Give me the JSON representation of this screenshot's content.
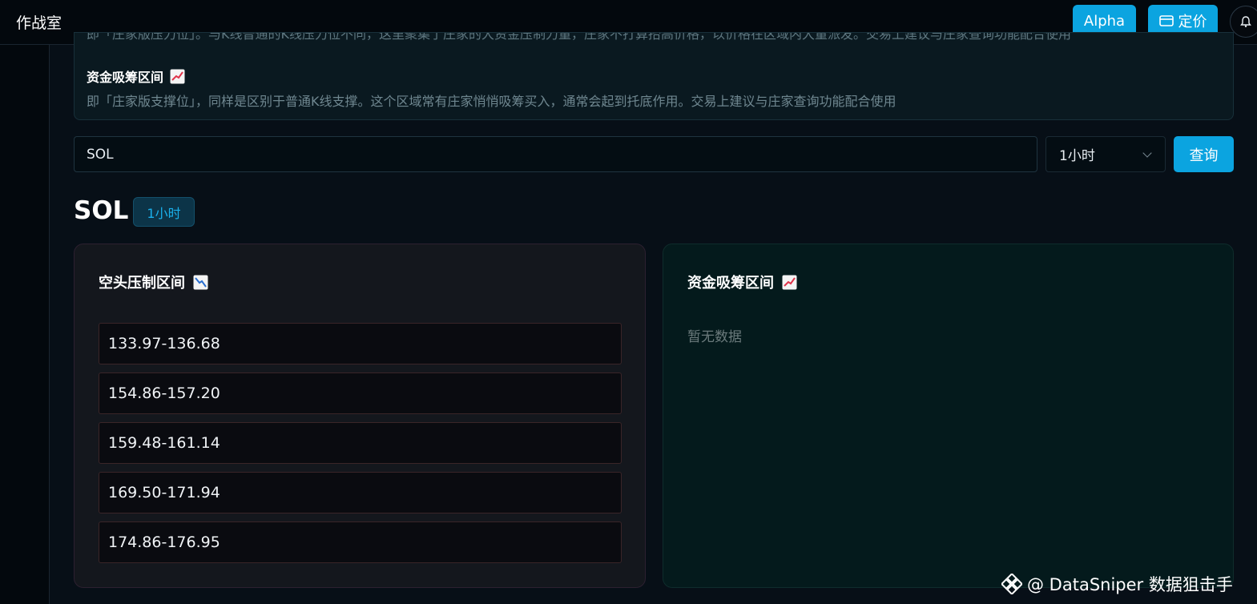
{
  "topbar": {
    "title": "作战室",
    "alpha_label": "Alpha",
    "pricing_label": "定价"
  },
  "info": {
    "cut_text": "即「庄家版压力位」。与K线普通的K线压力位不同，这里聚集了庄家的大资金压制力量，庄家不打算抬高价格，以价格在区域内大量派发。交易上建议与庄家查询功能配合使用",
    "accum_heading": "资金吸筹区间",
    "accum_desc": "即「庄家版支撑位」，同样是区别于普通K线支撑。这个区域常有庄家悄悄吸筹买入，通常会起到托底作用。交易上建议与庄家查询功能配合使用"
  },
  "search": {
    "value": "SOL",
    "interval_selected": "1小时",
    "query_label": "查询"
  },
  "result": {
    "symbol": "SOL",
    "interval_tag": "1小时"
  },
  "short_panel": {
    "title": "空头压制区间",
    "ranges": [
      "133.97-136.68",
      "154.86-157.20",
      "159.48-161.14",
      "169.50-171.94",
      "174.86-176.95"
    ]
  },
  "accum_panel": {
    "title": "资金吸筹区间",
    "empty_text": "暂无数据"
  },
  "watermark": {
    "text": "@ DataSniper 数据狙击手"
  },
  "colors": {
    "accent": "#0ba4e0",
    "background": "#070f17",
    "short_panel_border": "#3a2528",
    "accum_panel_bg": "#041a1c"
  },
  "icons": {
    "chart_down": "chart-decreasing-icon",
    "chart_up": "chart-increasing-icon",
    "card": "card-icon",
    "bell": "bell-icon"
  }
}
